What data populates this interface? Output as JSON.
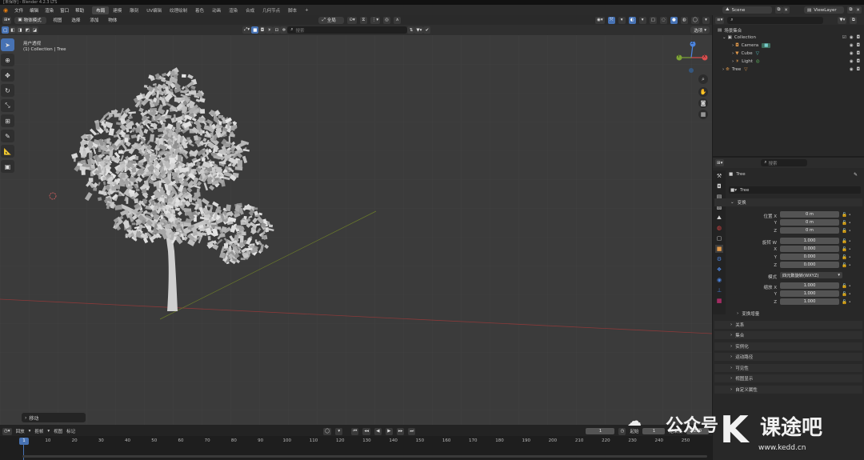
{
  "app": {
    "title": "[未保存] - Blender 4.2.3 LTS"
  },
  "menu": {
    "items": [
      "文件",
      "编辑",
      "渲染",
      "窗口",
      "帮助"
    ],
    "workspaces": [
      "布局",
      "建模",
      "雕刻",
      "UV编辑",
      "纹理绘制",
      "着色",
      "动画",
      "渲染",
      "合成",
      "几何节点",
      "脚本"
    ],
    "active_workspace": "布局",
    "add_workspace": "+",
    "scene": "Scene",
    "view_layer": "ViewLayer"
  },
  "viewport": {
    "mode": "物体模式",
    "menus": [
      "视图",
      "选择",
      "添加",
      "物体"
    ],
    "transform_orientation": "全局",
    "search_placeholder": "搜索",
    "options_label": "选项",
    "view_name": "用户透视",
    "collection_info": "(1) Collection | Tree",
    "gizmo": {
      "x": "X",
      "y": "Y",
      "z": "Z"
    },
    "operator_panel": "移动"
  },
  "outliner": {
    "search_placeholder": "",
    "root": "场景集合",
    "collection": "Collection",
    "items": [
      {
        "name": "Camera",
        "icon": "camera-icon"
      },
      {
        "name": "Cube",
        "icon": "mesh-icon"
      },
      {
        "name": "Light",
        "icon": "light-icon"
      },
      {
        "name": "Tree",
        "icon": "armature-icon"
      }
    ]
  },
  "properties": {
    "search_placeholder": "搜索",
    "object_name": "Tree",
    "object_field": "Tree",
    "transform_header": "变换",
    "location_label": "位置 X",
    "rotation_label": "旋转 W",
    "mode_label": "模式",
    "scale_label": "缩放 X",
    "axis_y": "Y",
    "axis_z": "Z",
    "axis_x": "X",
    "location": [
      "0 m",
      "0 m",
      "0 m"
    ],
    "rotation": [
      "1.000",
      "0.000",
      "0.000",
      "0.000"
    ],
    "rotation_mode": "四元数旋转(WXYZ)",
    "scale": [
      "1.000",
      "1.000",
      "1.000"
    ],
    "delta_transform": "变换增量",
    "panels": [
      "关系",
      "集合",
      "实例化",
      "运动路径",
      "可见性",
      "视图显示",
      "自定义属性"
    ]
  },
  "timeline": {
    "menus": [
      "回放",
      "抠帧",
      "视图",
      "标记"
    ],
    "current_frame": "1",
    "start_frame": "1",
    "end_frame": "250",
    "start_label": "起始",
    "end_label": "结束点",
    "ticks": [
      "1",
      "10",
      "20",
      "30",
      "40",
      "50",
      "60",
      "70",
      "80",
      "90",
      "100",
      "110",
      "120",
      "130",
      "140",
      "150",
      "160",
      "170",
      "180",
      "190",
      "200",
      "210",
      "220",
      "230",
      "240",
      "250"
    ]
  },
  "watermark": {
    "text": "公众号",
    "brand": "课途吧",
    "url": "www.kedd.cn"
  }
}
